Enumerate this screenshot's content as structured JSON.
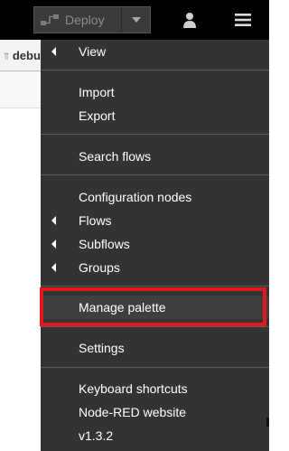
{
  "header": {
    "deploy_label": "Deploy",
    "icons": {
      "deploy": "deploy-flow-icon",
      "caret": "chevron-down-icon",
      "user": "user-icon",
      "menu": "hamburger-menu-icon"
    }
  },
  "tab": {
    "label": "debu"
  },
  "menu": {
    "view": "View",
    "import": "Import",
    "export": "Export",
    "search_flows": "Search flows",
    "configuration_nodes": "Configuration nodes",
    "flows": "Flows",
    "subflows": "Subflows",
    "groups": "Groups",
    "manage_palette": "Manage palette",
    "settings": "Settings",
    "keyboard_shortcuts": "Keyboard shortcuts",
    "node_red_website": "Node-RED website",
    "version": "v1.3.2"
  },
  "colors": {
    "header_bg": "#000000",
    "menu_bg": "#333333",
    "highlight_border": "#e1191c"
  }
}
